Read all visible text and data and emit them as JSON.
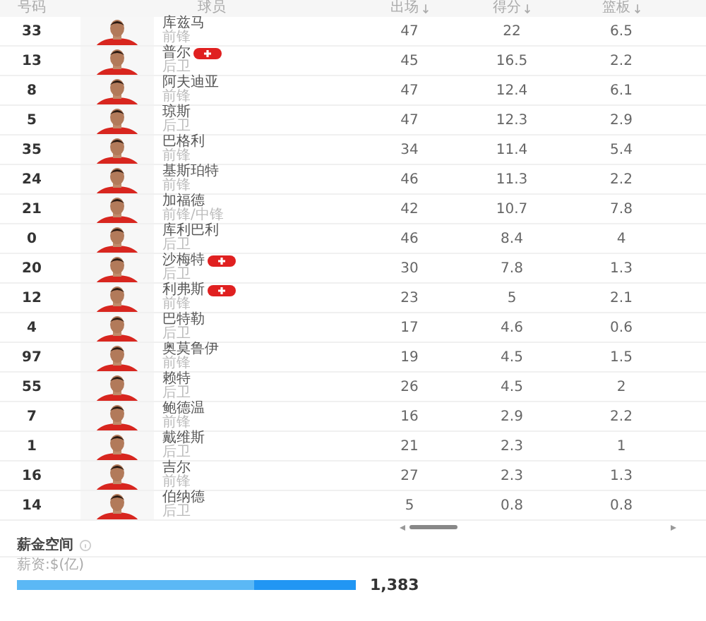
{
  "table": {
    "columns": [
      {
        "label": "号码",
        "sortable": false
      },
      {
        "label": "球员",
        "sortable": false
      },
      {
        "label": "出场",
        "sortable": true
      },
      {
        "label": "得分",
        "sortable": true
      },
      {
        "label": "篮板",
        "sortable": true
      }
    ],
    "rows": [
      {
        "number": "33",
        "name": "库兹马",
        "position": "前锋",
        "injured": false,
        "games": "47",
        "points": "22",
        "rebounds": "6.5"
      },
      {
        "number": "13",
        "name": "普尔",
        "position": "后卫",
        "injured": true,
        "games": "45",
        "points": "16.5",
        "rebounds": "2.2"
      },
      {
        "number": "8",
        "name": "阿夫迪亚",
        "position": "前锋",
        "injured": false,
        "games": "47",
        "points": "12.4",
        "rebounds": "6.1"
      },
      {
        "number": "5",
        "name": "琼斯",
        "position": "后卫",
        "injured": false,
        "games": "47",
        "points": "12.3",
        "rebounds": "2.9"
      },
      {
        "number": "35",
        "name": "巴格利",
        "position": "前锋",
        "injured": false,
        "games": "34",
        "points": "11.4",
        "rebounds": "5.4"
      },
      {
        "number": "24",
        "name": "基斯珀特",
        "position": "前锋",
        "injured": false,
        "games": "46",
        "points": "11.3",
        "rebounds": "2.2"
      },
      {
        "number": "21",
        "name": "加福德",
        "position": "前锋/中锋",
        "injured": false,
        "games": "42",
        "points": "10.7",
        "rebounds": "7.8"
      },
      {
        "number": "0",
        "name": "库利巴利",
        "position": "后卫",
        "injured": false,
        "games": "46",
        "points": "8.4",
        "rebounds": "4"
      },
      {
        "number": "20",
        "name": "沙梅特",
        "position": "后卫",
        "injured": true,
        "games": "30",
        "points": "7.8",
        "rebounds": "1.3"
      },
      {
        "number": "12",
        "name": "利弗斯",
        "position": "前锋",
        "injured": true,
        "games": "23",
        "points": "5",
        "rebounds": "2.1"
      },
      {
        "number": "4",
        "name": "巴特勒",
        "position": "后卫",
        "injured": false,
        "games": "17",
        "points": "4.6",
        "rebounds": "0.6"
      },
      {
        "number": "97",
        "name": "奥莫鲁伊",
        "position": "前锋",
        "injured": false,
        "games": "19",
        "points": "4.5",
        "rebounds": "1.5"
      },
      {
        "number": "55",
        "name": "赖特",
        "position": "后卫",
        "injured": false,
        "games": "26",
        "points": "4.5",
        "rebounds": "2"
      },
      {
        "number": "7",
        "name": "鲍德温",
        "position": "前锋",
        "injured": false,
        "games": "16",
        "points": "2.9",
        "rebounds": "2.2"
      },
      {
        "number": "1",
        "name": "戴维斯",
        "position": "后卫",
        "injured": false,
        "games": "21",
        "points": "2.3",
        "rebounds": "1"
      },
      {
        "number": "16",
        "name": "吉尔",
        "position": "前锋",
        "injured": false,
        "games": "27",
        "points": "2.3",
        "rebounds": "1.3"
      },
      {
        "number": "14",
        "name": "伯纳德",
        "position": "后卫",
        "injured": false,
        "games": "5",
        "points": "0.8",
        "rebounds": "0.8"
      }
    ]
  },
  "salary": {
    "title": "薪金空间",
    "label": "薪资:$(亿)",
    "level": 0.7,
    "value": "1,383"
  }
}
